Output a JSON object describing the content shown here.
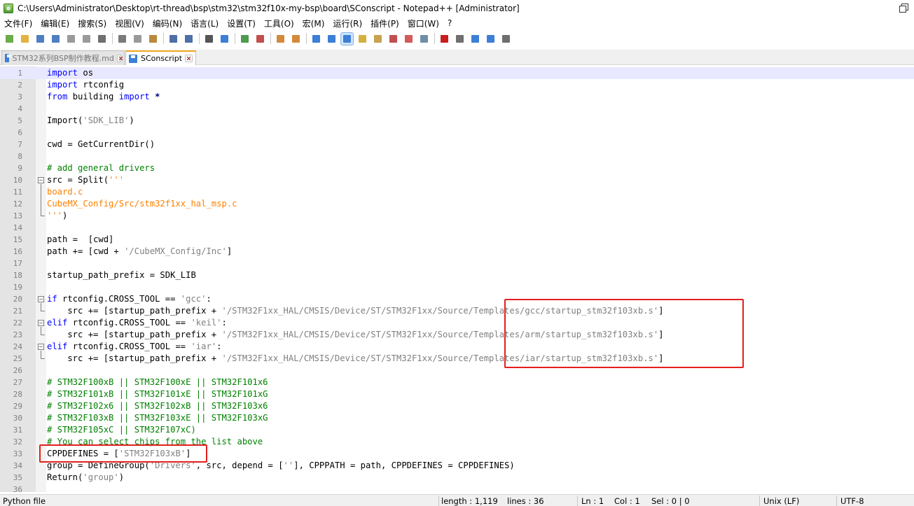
{
  "window": {
    "title": "C:\\Users\\Administrator\\Desktop\\rt-thread\\bsp\\stm32\\stm32f10x-my-bsp\\board\\SConscript - Notepad++ [Administrator]"
  },
  "menu": [
    "文件(F)",
    "编辑(E)",
    "搜索(S)",
    "视图(V)",
    "编码(N)",
    "语言(L)",
    "设置(T)",
    "工具(O)",
    "宏(M)",
    "运行(R)",
    "插件(P)",
    "窗口(W)",
    "?"
  ],
  "toolbar": {
    "groups": [
      [
        {
          "name": "new-file-icon",
          "color": "#6cab4a"
        },
        {
          "name": "open-file-icon",
          "color": "#e3b341"
        },
        {
          "name": "save-icon",
          "color": "#4f7fc2"
        },
        {
          "name": "save-all-icon",
          "color": "#4f7fc2"
        },
        {
          "name": "close-icon",
          "color": "#9a9a9a"
        },
        {
          "name": "close-all-icon",
          "color": "#9a9a9a"
        },
        {
          "name": "print-icon",
          "color": "#6f6f6f"
        }
      ],
      [
        {
          "name": "cut-icon",
          "color": "#7a7a7a"
        },
        {
          "name": "copy-icon",
          "color": "#9a9a9a"
        },
        {
          "name": "paste-icon",
          "color": "#b88a3c"
        }
      ],
      [
        {
          "name": "undo-icon",
          "color": "#4f6fa8"
        },
        {
          "name": "redo-icon",
          "color": "#4f6fa8"
        }
      ],
      [
        {
          "name": "find-icon",
          "color": "#555555"
        },
        {
          "name": "replace-icon",
          "color": "#3d7fd6"
        }
      ],
      [
        {
          "name": "zoom-in-icon",
          "color": "#4f9a4f"
        },
        {
          "name": "zoom-out-icon",
          "color": "#c24f4f"
        }
      ],
      [
        {
          "name": "sync-vertical-icon",
          "color": "#d48a3c"
        },
        {
          "name": "sync-horizontal-icon",
          "color": "#d48a3c"
        }
      ],
      [
        {
          "name": "word-wrap-icon",
          "color": "#3d7fd6"
        },
        {
          "name": "show-all-chars-icon",
          "color": "#3d7fd6"
        },
        {
          "name": "indent-guide-icon",
          "color": "#3d7fd6",
          "active": true
        },
        {
          "name": "language-icon",
          "color": "#d4b13c"
        },
        {
          "name": "doc-map-icon",
          "color": "#c9a24f"
        },
        {
          "name": "function-list-icon",
          "color": "#c24f4f"
        },
        {
          "name": "folder-workspace-icon",
          "color": "#d45a5a"
        },
        {
          "name": "monitoring-icon",
          "color": "#6f8fa8"
        }
      ],
      [
        {
          "name": "record-macro-icon",
          "color": "#c81e1e"
        },
        {
          "name": "stop-record-icon",
          "color": "#6f6f6f"
        },
        {
          "name": "play-macro-icon",
          "color": "#3d7fd6"
        },
        {
          "name": "run-macro-multiple-icon",
          "color": "#3d7fd6"
        },
        {
          "name": "save-macro-icon",
          "color": "#6f6f6f"
        }
      ]
    ]
  },
  "tabs": [
    {
      "label": "STM32系列BSP制作教程.md",
      "active": false
    },
    {
      "label": "SConscript",
      "active": true
    }
  ],
  "code_lines": [
    [
      [
        "kw",
        "import"
      ],
      [
        "t",
        " os"
      ]
    ],
    [
      [
        "kw",
        "import"
      ],
      [
        "t",
        " rtconfig"
      ]
    ],
    [
      [
        "kw",
        "from"
      ],
      [
        "t",
        " building "
      ],
      [
        "kw",
        "import"
      ],
      [
        "t",
        " "
      ],
      [
        "op",
        "*"
      ]
    ],
    [],
    [
      [
        "t",
        "Import("
      ],
      [
        "str",
        "'SDK_LIB'"
      ],
      [
        "t",
        ")"
      ]
    ],
    [],
    [
      [
        "t",
        "cwd = GetCurrentDir()"
      ]
    ],
    [],
    [
      [
        "cm",
        "# add general drivers"
      ]
    ],
    [
      [
        "t",
        "src = Split("
      ],
      [
        "sq",
        "'''"
      ]
    ],
    [
      [
        "sq",
        "board.c"
      ]
    ],
    [
      [
        "sq",
        "CubeMX_Config/Src/stm32f1xx_hal_msp.c"
      ]
    ],
    [
      [
        "sq",
        "'''"
      ],
      [
        "t",
        ")"
      ]
    ],
    [],
    [
      [
        "t",
        "path =  [cwd]"
      ]
    ],
    [
      [
        "t",
        "path += [cwd + "
      ],
      [
        "str",
        "'/CubeMX_Config/Inc'"
      ],
      [
        "t",
        "]"
      ]
    ],
    [],
    [
      [
        "t",
        "startup_path_prefix = SDK_LIB"
      ]
    ],
    [],
    [
      [
        "kw",
        "if"
      ],
      [
        "t",
        " rtconfig.CROSS_TOOL == "
      ],
      [
        "str",
        "'gcc'"
      ],
      [
        "t",
        ":"
      ]
    ],
    [
      [
        "t",
        "    src += [startup_path_prefix + "
      ],
      [
        "str",
        "'/STM32F1xx_HAL/CMSIS/Device/ST/STM32F1xx/Source/Templates/gcc/startup_stm32f103xb.s'"
      ],
      [
        "t",
        "]"
      ]
    ],
    [
      [
        "kw",
        "elif"
      ],
      [
        "t",
        " rtconfig.CROSS_TOOL == "
      ],
      [
        "str",
        "'keil'"
      ],
      [
        "t",
        ":"
      ]
    ],
    [
      [
        "t",
        "    src += [startup_path_prefix + "
      ],
      [
        "str",
        "'/STM32F1xx_HAL/CMSIS/Device/ST/STM32F1xx/Source/Templates/arm/startup_stm32f103xb.s'"
      ],
      [
        "t",
        "]"
      ]
    ],
    [
      [
        "kw",
        "elif"
      ],
      [
        "t",
        " rtconfig.CROSS_TOOL == "
      ],
      [
        "str",
        "'iar'"
      ],
      [
        "t",
        ":"
      ]
    ],
    [
      [
        "t",
        "    src += [startup_path_prefix + "
      ],
      [
        "str",
        "'/STM32F1xx_HAL/CMSIS/Device/ST/STM32F1xx/Source/Templates/iar/startup_stm32f103xb.s'"
      ],
      [
        "t",
        "]"
      ]
    ],
    [],
    [
      [
        "cm",
        "# STM32F100xB || STM32F100xE || STM32F101x6"
      ]
    ],
    [
      [
        "cm",
        "# STM32F101xB || STM32F101xE || STM32F101xG"
      ]
    ],
    [
      [
        "cm",
        "# STM32F102x6 || STM32F102xB || STM32F103x6"
      ]
    ],
    [
      [
        "cm",
        "# STM32F103xB || STM32F103xE || STM32F103xG"
      ]
    ],
    [
      [
        "cm",
        "# STM32F105xC || STM32F107xC)"
      ]
    ],
    [
      [
        "cm",
        "# You can select chips from the list above"
      ]
    ],
    [
      [
        "t",
        "CPPDEFINES = ["
      ],
      [
        "str",
        "'STM32F103xB'"
      ],
      [
        "t",
        "]"
      ]
    ],
    [
      [
        "t",
        "group = DefineGroup("
      ],
      [
        "str",
        "'Drivers'"
      ],
      [
        "t",
        ", src, depend = ["
      ],
      [
        "str",
        "''"
      ],
      [
        "t",
        "], CPPPATH = path, CPPDEFINES = CPPDEFINES)"
      ]
    ],
    [
      [
        "t",
        "Return("
      ],
      [
        "str",
        "'group'"
      ],
      [
        "t",
        ")"
      ]
    ],
    []
  ],
  "status": {
    "file_type": "Python file",
    "length": "length : 1,119",
    "lines": "lines : 36",
    "ln": "Ln : 1",
    "col": "Col : 1",
    "sel": "Sel : 0 | 0",
    "eol": "Unix (LF)",
    "encoding": "UTF-8"
  }
}
